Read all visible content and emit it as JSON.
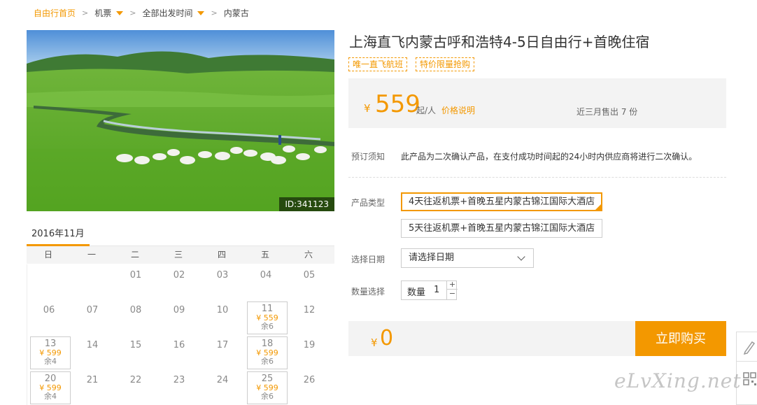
{
  "breadcrumb": {
    "home": "自由行首页",
    "category": "机票",
    "departure": "全部出发时间",
    "destination": "内蒙古"
  },
  "photo": {
    "id_label": "ID:341123"
  },
  "calendar": {
    "month_tab": "2016年11月",
    "weekdays": [
      "日",
      "一",
      "二",
      "三",
      "四",
      "五",
      "六"
    ],
    "days": [
      {
        "d": "01",
        "col": 2,
        "row": 0
      },
      {
        "d": "02",
        "col": 3,
        "row": 0
      },
      {
        "d": "03",
        "col": 4,
        "row": 0
      },
      {
        "d": "04",
        "col": 5,
        "row": 0
      },
      {
        "d": "05",
        "col": 6,
        "row": 0
      },
      {
        "d": "06",
        "col": 0,
        "row": 1
      },
      {
        "d": "07",
        "col": 1,
        "row": 1
      },
      {
        "d": "08",
        "col": 2,
        "row": 1
      },
      {
        "d": "09",
        "col": 3,
        "row": 1
      },
      {
        "d": "10",
        "col": 4,
        "row": 1
      },
      {
        "d": "11",
        "col": 5,
        "row": 1,
        "price": "¥ 559",
        "rest": "余6"
      },
      {
        "d": "12",
        "col": 6,
        "row": 1
      },
      {
        "d": "13",
        "col": 0,
        "row": 2,
        "price": "¥ 599",
        "rest": "余4"
      },
      {
        "d": "14",
        "col": 1,
        "row": 2
      },
      {
        "d": "15",
        "col": 2,
        "row": 2
      },
      {
        "d": "16",
        "col": 3,
        "row": 2
      },
      {
        "d": "17",
        "col": 4,
        "row": 2
      },
      {
        "d": "18",
        "col": 5,
        "row": 2,
        "price": "¥ 599",
        "rest": "余6"
      },
      {
        "d": "19",
        "col": 6,
        "row": 2
      },
      {
        "d": "20",
        "col": 0,
        "row": 3,
        "price": "¥ 599",
        "rest": "余4"
      },
      {
        "d": "21",
        "col": 1,
        "row": 3
      },
      {
        "d": "22",
        "col": 2,
        "row": 3
      },
      {
        "d": "23",
        "col": 3,
        "row": 3
      },
      {
        "d": "24",
        "col": 4,
        "row": 3
      },
      {
        "d": "25",
        "col": 5,
        "row": 3,
        "price": "¥ 599",
        "rest": "余6"
      },
      {
        "d": "26",
        "col": 6,
        "row": 3
      }
    ]
  },
  "product": {
    "title": "上海直飞内蒙古呼和浩特4-5日自由行+首晚住宿",
    "tags": [
      "唯一直飞航班",
      "特价限量抢购"
    ],
    "price_symbol": "¥",
    "price": "559",
    "price_suffix": "起/人",
    "price_explain": "价格说明",
    "sold": "近三月售出 7 份",
    "notice_label": "预订须知",
    "notice_text": "此产品为二次确认产品，在支付成功时间起的24小时内供应商将进行二次确认。",
    "type_label": "产品类型",
    "types": [
      "4天往返机票+首晚五星内蒙古锦江国际大酒店",
      "5天往返机票+首晚五星内蒙古锦江国际大酒店"
    ],
    "date_label": "选择日期",
    "date_placeholder": "请选择日期",
    "qty_label": "数量选择",
    "qty_inner_label": "数量",
    "qty_value": "1",
    "qty_plus": "+",
    "qty_minus": "−",
    "total_symbol": "¥",
    "total": "0",
    "buy_label": "立即购买"
  },
  "watermark": "eLvXing.net",
  "colors": {
    "accent": "#f39800",
    "panel": "#f3f3f3"
  }
}
